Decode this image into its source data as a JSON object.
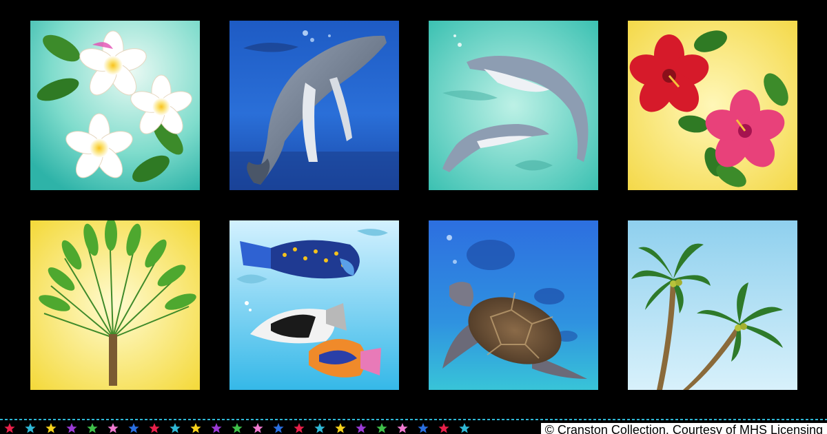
{
  "panels": [
    {
      "subject": "plumeria-flowers"
    },
    {
      "subject": "humpback-whale"
    },
    {
      "subject": "dolphins"
    },
    {
      "subject": "hibiscus-flowers"
    },
    {
      "subject": "travelers-palm"
    },
    {
      "subject": "tropical-fish"
    },
    {
      "subject": "sea-turtle"
    },
    {
      "subject": "coconut-palms"
    }
  ],
  "border": {
    "star_colors": [
      "#e8204a",
      "#2fb8d6",
      "#f5d21c",
      "#9b3bd6",
      "#3fc04a",
      "#f07ad0",
      "#2a6fe0"
    ]
  },
  "credit": {
    "text": "© Cranston Collection. Courtesy of MHS Licensing"
  }
}
